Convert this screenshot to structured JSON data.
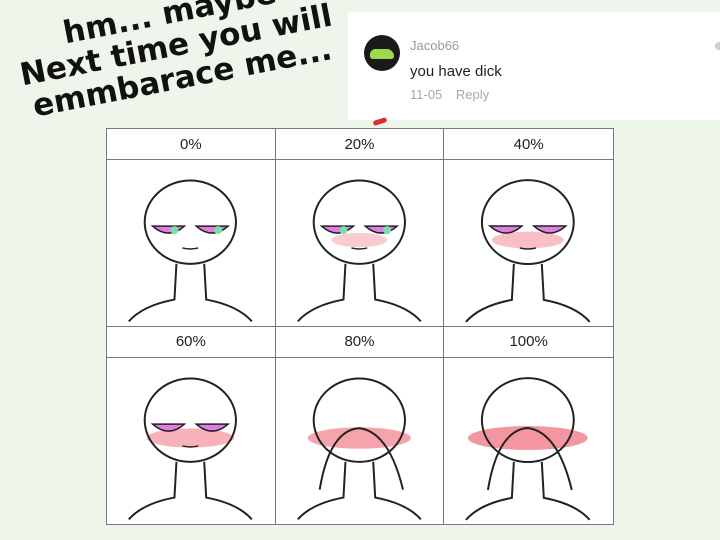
{
  "caption": {
    "lines": [
      "hm... maybe",
      "Next time you will",
      "emmbarace me..."
    ]
  },
  "comment": {
    "avatar_icon": "car-avatar-icon",
    "username": "Jacob66",
    "text": "you have dick",
    "date": "11-05",
    "reply_label": "Reply"
  },
  "chart": {
    "panels": [
      {
        "label": "0%",
        "blush": 0,
        "eyes": "pink-green"
      },
      {
        "label": "20%",
        "blush": 0.2,
        "eyes": "pink-green"
      },
      {
        "label": "40%",
        "blush": 0.4,
        "eyes": "pink"
      },
      {
        "label": "60%",
        "blush": 0.6,
        "eyes": "pink"
      },
      {
        "label": "80%",
        "blush": 0.8,
        "eyes": "covered"
      },
      {
        "label": "100%",
        "blush": 1.0,
        "eyes": "covered"
      }
    ],
    "colors": {
      "eye": "#e27be6",
      "eye_accent": "#77e0a8",
      "blush": "#f06a78",
      "line": "#222222"
    }
  }
}
